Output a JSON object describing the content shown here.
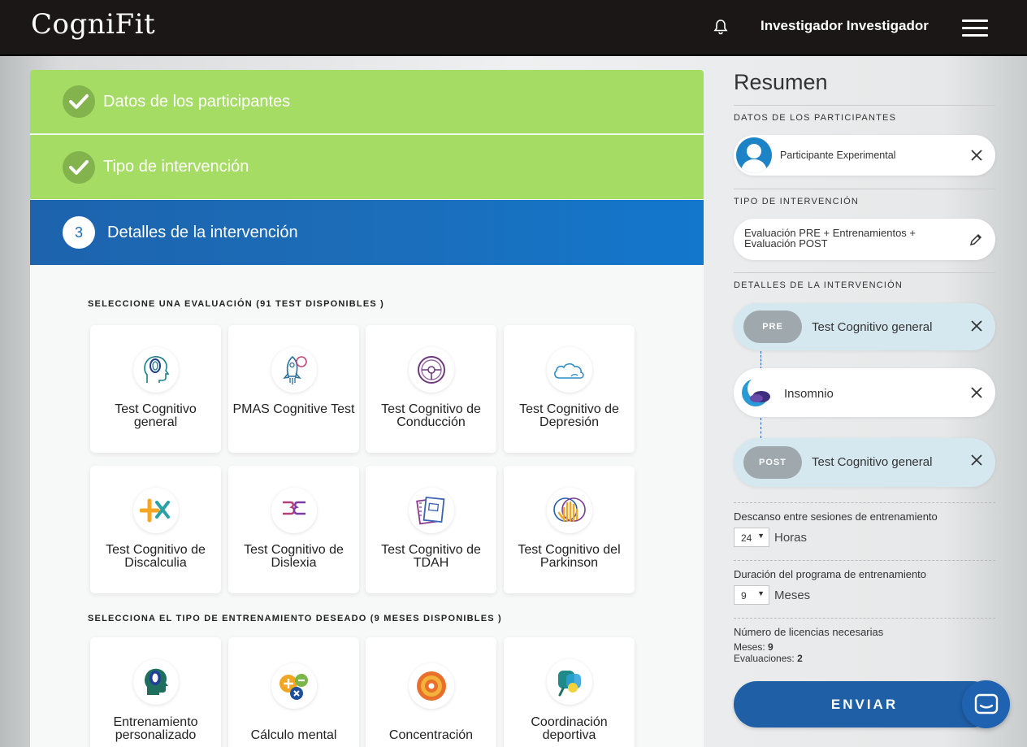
{
  "header": {
    "logo_text": "CogniFit",
    "user_name": "Investigador Investigador"
  },
  "steps": {
    "step1": {
      "label": "Datos de los participantes"
    },
    "step2": {
      "label": "Tipo de intervención"
    },
    "step3": {
      "number": "3",
      "label": "Detalles de la intervención"
    }
  },
  "evaluation": {
    "title": "SELECCIONE UNA EVALUACIÓN (91 TEST DISPONIBLES )",
    "cards": [
      {
        "label": "Test Cognitivo general",
        "icon": "head-brain-icon"
      },
      {
        "label": "PMAS Cognitive Test",
        "icon": "rocket-icon"
      },
      {
        "label": "Test Cognitivo de Conducción",
        "icon": "steering-wheel-icon"
      },
      {
        "label": "Test Cognitivo de Depresión",
        "icon": "cloud-icon"
      },
      {
        "label": "Test Cognitivo de Discalculia",
        "icon": "math-symbols-icon"
      },
      {
        "label": "Test Cognitivo de Dislexia",
        "icon": "letters-icon"
      },
      {
        "label": "Test Cognitivo de TDAH",
        "icon": "notebook-icon"
      },
      {
        "label": "Test Cognitivo del Parkinson",
        "icon": "hand-icon"
      }
    ]
  },
  "training": {
    "title": "SELECCIONA EL TIPO DE ENTRENAMIENTO DESEADO (9 MESES DISPONIBLES )",
    "cards": [
      {
        "label": "Entrenamiento personalizado",
        "icon": "head-brain-icon"
      },
      {
        "label": "Cálculo mental",
        "icon": "math-bubbles-icon"
      },
      {
        "label": "Concentración",
        "icon": "target-icon"
      },
      {
        "label": "Coordinación deportiva",
        "icon": "coordination-icon"
      }
    ]
  },
  "summary": {
    "title": "Resumen",
    "participants_caption": "DATOS DE LOS PARTICIPANTES",
    "participant": "Participante Experimental",
    "intervention_caption": "TIPO DE INTERVENCIÓN",
    "intervention_type": "Evaluación PRE + Entrenamientos + Evaluación POST",
    "details_caption": "DETALLES DE LA INTERVENCIÓN",
    "pre_tag": "PRE",
    "pre_test": "Test Cognitivo general",
    "training_program": "Insomnio",
    "post_tag": "POST",
    "post_test": "Test Cognitivo general",
    "rest_label": "Descanso entre sesiones de entrenamiento",
    "rest_value": "24",
    "rest_unit": "Horas",
    "duration_label": "Duración del programa de entrenamiento",
    "duration_value": "9",
    "duration_unit": "Meses",
    "licenses_label": "Número de licencias necesarias",
    "months_label": "Meses:",
    "months_value": "9",
    "evals_label": "Evaluaciones:",
    "evals_value": "2",
    "send_label": "ENVIAR"
  }
}
